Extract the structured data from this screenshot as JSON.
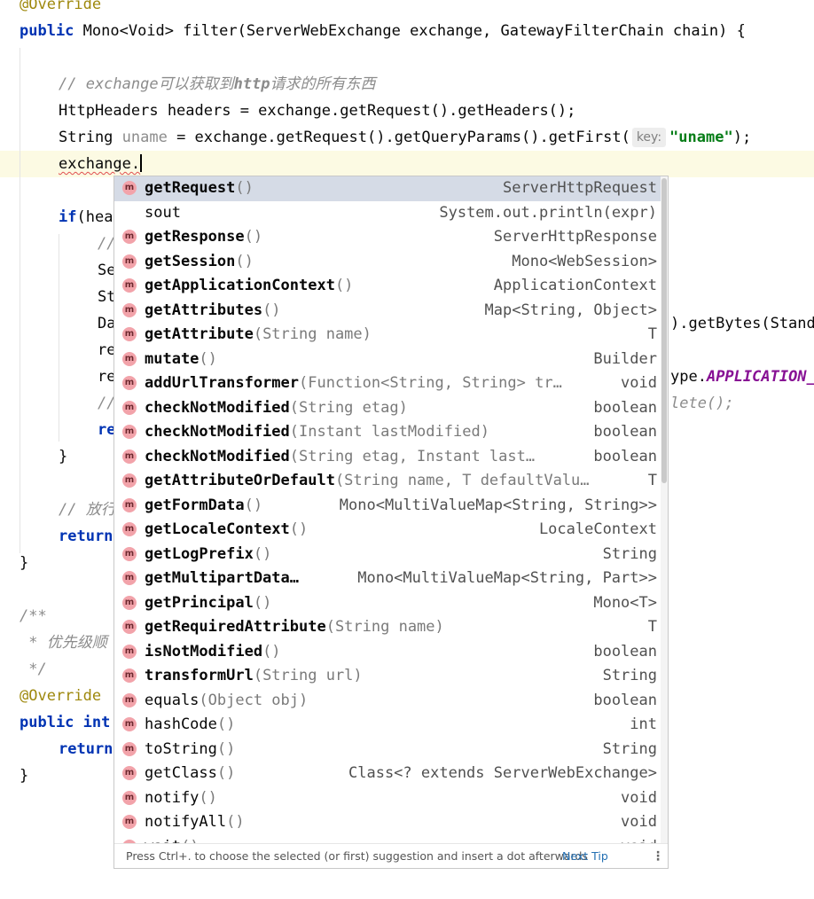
{
  "code": {
    "l0_annotation": "@Override",
    "l1": {
      "kw": "public",
      "rest": " Mono<Void> filter(ServerWebExchange exchange, GatewayFilterChain chain) {"
    },
    "l3_comment_a": "// exchange可以获取到",
    "l3_comment_b": "http",
    "l3_comment_c": "请求的所有东西",
    "l4": "HttpHeaders headers = exchange.getRequest().getHeaders();",
    "l5": {
      "type": "String ",
      "var": "uname",
      "mid": " = exchange.getRequest().getQueryParams().getFirst(",
      "hint": "key:",
      "str": "\"uname\"",
      "end": ");"
    },
    "l6": "exchange.",
    "l8": {
      "kw": "if",
      "rest": "(hea"
    },
    "l9": "//",
    "l10": "Se",
    "l11": "St",
    "l12": "Da",
    "l12_right": ").getBytes(Stand",
    "l13": "re",
    "l14": "re",
    "l14_right_a": "ype.",
    "l14_right_b": "APPLICATION_",
    "l15": "//",
    "l15_right": "lete();",
    "l16": "re",
    "l17": "}",
    "l19": "// 放行",
    "l20": "return",
    "l21": "}",
    "l23": "/**",
    "l24": " * 优先级顺",
    "l25": " */",
    "l26": "@Override",
    "l27": {
      "kw": "public int",
      "rest": ""
    },
    "l28": "return",
    "l29": "}"
  },
  "completion": {
    "items": [
      {
        "icon": "m",
        "name": "getRequest",
        "params": "()",
        "type": "ServerHttpRequest",
        "selected": true
      },
      {
        "icon": "",
        "name": "sout",
        "params": "",
        "type": "System.out.println(expr)",
        "plain": true
      },
      {
        "icon": "m",
        "name": "getResponse",
        "params": "()",
        "type": "ServerHttpResponse"
      },
      {
        "icon": "m",
        "name": "getSession",
        "params": "()",
        "type": "Mono<WebSession>"
      },
      {
        "icon": "m",
        "name": "getApplicationContext",
        "params": "()",
        "type": "ApplicationContext"
      },
      {
        "icon": "m",
        "name": "getAttributes",
        "params": "()",
        "type": "Map<String, Object>"
      },
      {
        "icon": "m",
        "name": "getAttribute",
        "params": "(String name)",
        "type": "T"
      },
      {
        "icon": "m",
        "name": "mutate",
        "params": "()",
        "type": "Builder"
      },
      {
        "icon": "m",
        "name": "addUrlTransformer",
        "params": "(Function<String, String> tr…",
        "type": "void"
      },
      {
        "icon": "m",
        "name": "checkNotModified",
        "params": "(String etag)",
        "type": "boolean"
      },
      {
        "icon": "m",
        "name": "checkNotModified",
        "params": "(Instant lastModified)",
        "type": "boolean"
      },
      {
        "icon": "m",
        "name": "checkNotModified",
        "params": "(String etag, Instant last…",
        "type": "boolean"
      },
      {
        "icon": "m",
        "name": "getAttributeOrDefault",
        "params": "(String name, T defaultValu…",
        "type": "T"
      },
      {
        "icon": "m",
        "name": "getFormData",
        "params": "()",
        "type": "Mono<MultiValueMap<String, String>>"
      },
      {
        "icon": "m",
        "name": "getLocaleContext",
        "params": "()",
        "type": "LocaleContext"
      },
      {
        "icon": "m",
        "name": "getLogPrefix",
        "params": "()",
        "type": "String"
      },
      {
        "icon": "m",
        "name": "getMultipartData…",
        "params": "",
        "type": "Mono<MultiValueMap<String, Part>>"
      },
      {
        "icon": "m",
        "name": "getPrincipal",
        "params": "()",
        "type": "Mono<T>"
      },
      {
        "icon": "m",
        "name": "getRequiredAttribute",
        "params": "(String name)",
        "type": "T"
      },
      {
        "icon": "m",
        "name": "isNotModified",
        "params": "()",
        "type": "boolean"
      },
      {
        "icon": "m",
        "name": "transformUrl",
        "params": "(String url)",
        "type": "String"
      },
      {
        "icon": "m",
        "name": "equals",
        "params": "(Object obj)",
        "type": "boolean",
        "plain": true
      },
      {
        "icon": "m",
        "name": "hashCode",
        "params": "()",
        "type": "int",
        "plain": true
      },
      {
        "icon": "m",
        "name": "toString",
        "params": "()",
        "type": "String",
        "plain": true
      },
      {
        "icon": "m",
        "name": "getClass",
        "params": "()",
        "type": "Class<? extends ServerWebExchange>",
        "plain": true
      },
      {
        "icon": "m",
        "name": "notify",
        "params": "()",
        "type": "void",
        "plain": true
      },
      {
        "icon": "m",
        "name": "notifyAll",
        "params": "()",
        "type": "void",
        "plain": true
      },
      {
        "icon": "m",
        "name": "wait",
        "params": "()",
        "type": "void",
        "plain": true
      }
    ],
    "footer_text": "Press Ctrl+. to choose the selected (or first) suggestion and insert a dot afterwards",
    "footer_link": "Next Tip",
    "footer_menu": "⋮"
  },
  "colors": {
    "keyword": "#0033b3",
    "annotation": "#9e880d",
    "string": "#067d17",
    "comment": "#8c8c8c",
    "selection": "#d5dbe6",
    "method_icon": "#f2a3aa",
    "link": "#2470b3"
  }
}
